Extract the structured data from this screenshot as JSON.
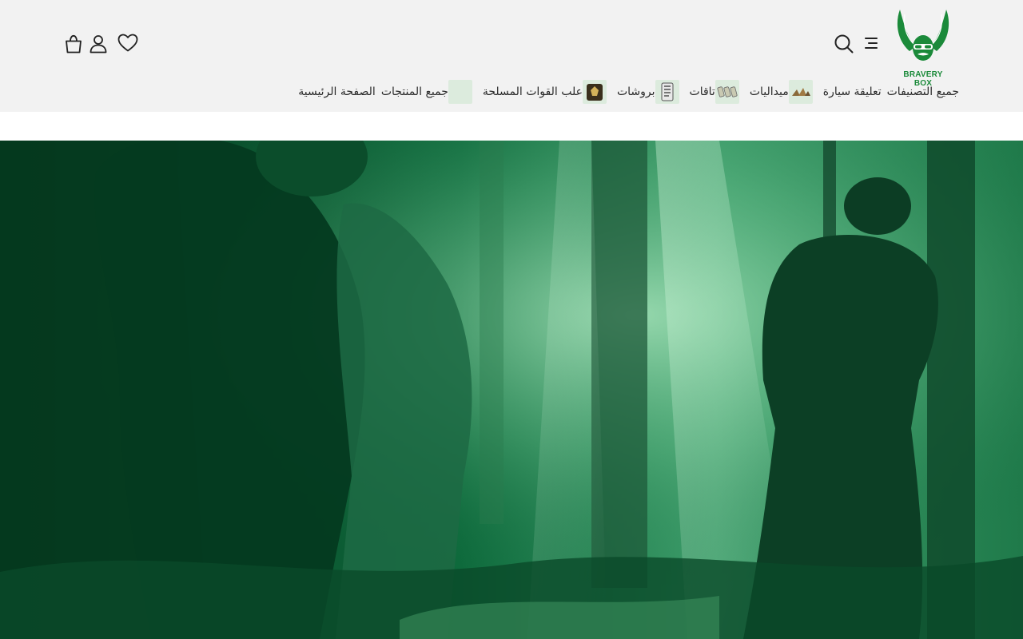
{
  "brand": {
    "logo_text": "BRAVERY BOX",
    "accent_color": "#1b8a3a"
  },
  "header": {
    "icons": {
      "menu": "menu-icon",
      "search": "search-icon",
      "wishlist": "heart-icon",
      "account": "user-icon",
      "cart": "shopping-bag-icon"
    }
  },
  "nav": {
    "items": [
      {
        "label": "الصفحة الرئيسية",
        "has_thumb": false
      },
      {
        "label": "جميع المنتجات",
        "has_thumb": true
      },
      {
        "label": "علب القوات المسلحة",
        "has_thumb": true
      },
      {
        "label": "بروشات",
        "has_thumb": true
      },
      {
        "label": "تاقات",
        "has_thumb": true
      },
      {
        "label": "ميداليات",
        "has_thumb": true
      },
      {
        "label": "تعليقة سيارة",
        "has_thumb": false
      },
      {
        "label": "جميع التصنيفات",
        "has_thumb": false
      }
    ]
  },
  "hero": {
    "image": "forest-soldiers-banner",
    "tint_color": "#0b5a33"
  }
}
